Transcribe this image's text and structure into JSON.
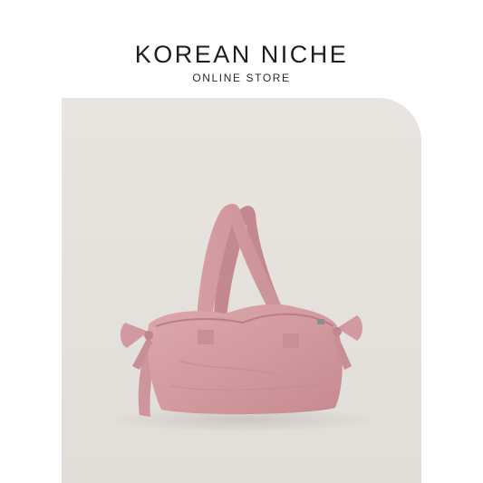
{
  "brand": {
    "name": "KOREAN NICHE",
    "tagline": "ONLINE STORE"
  },
  "product": {
    "image_icon": "pink-nylon-shoulder-bag-with-side-bows",
    "background_color": "#e6e3df",
    "bag_color": "#d8a1a6"
  }
}
